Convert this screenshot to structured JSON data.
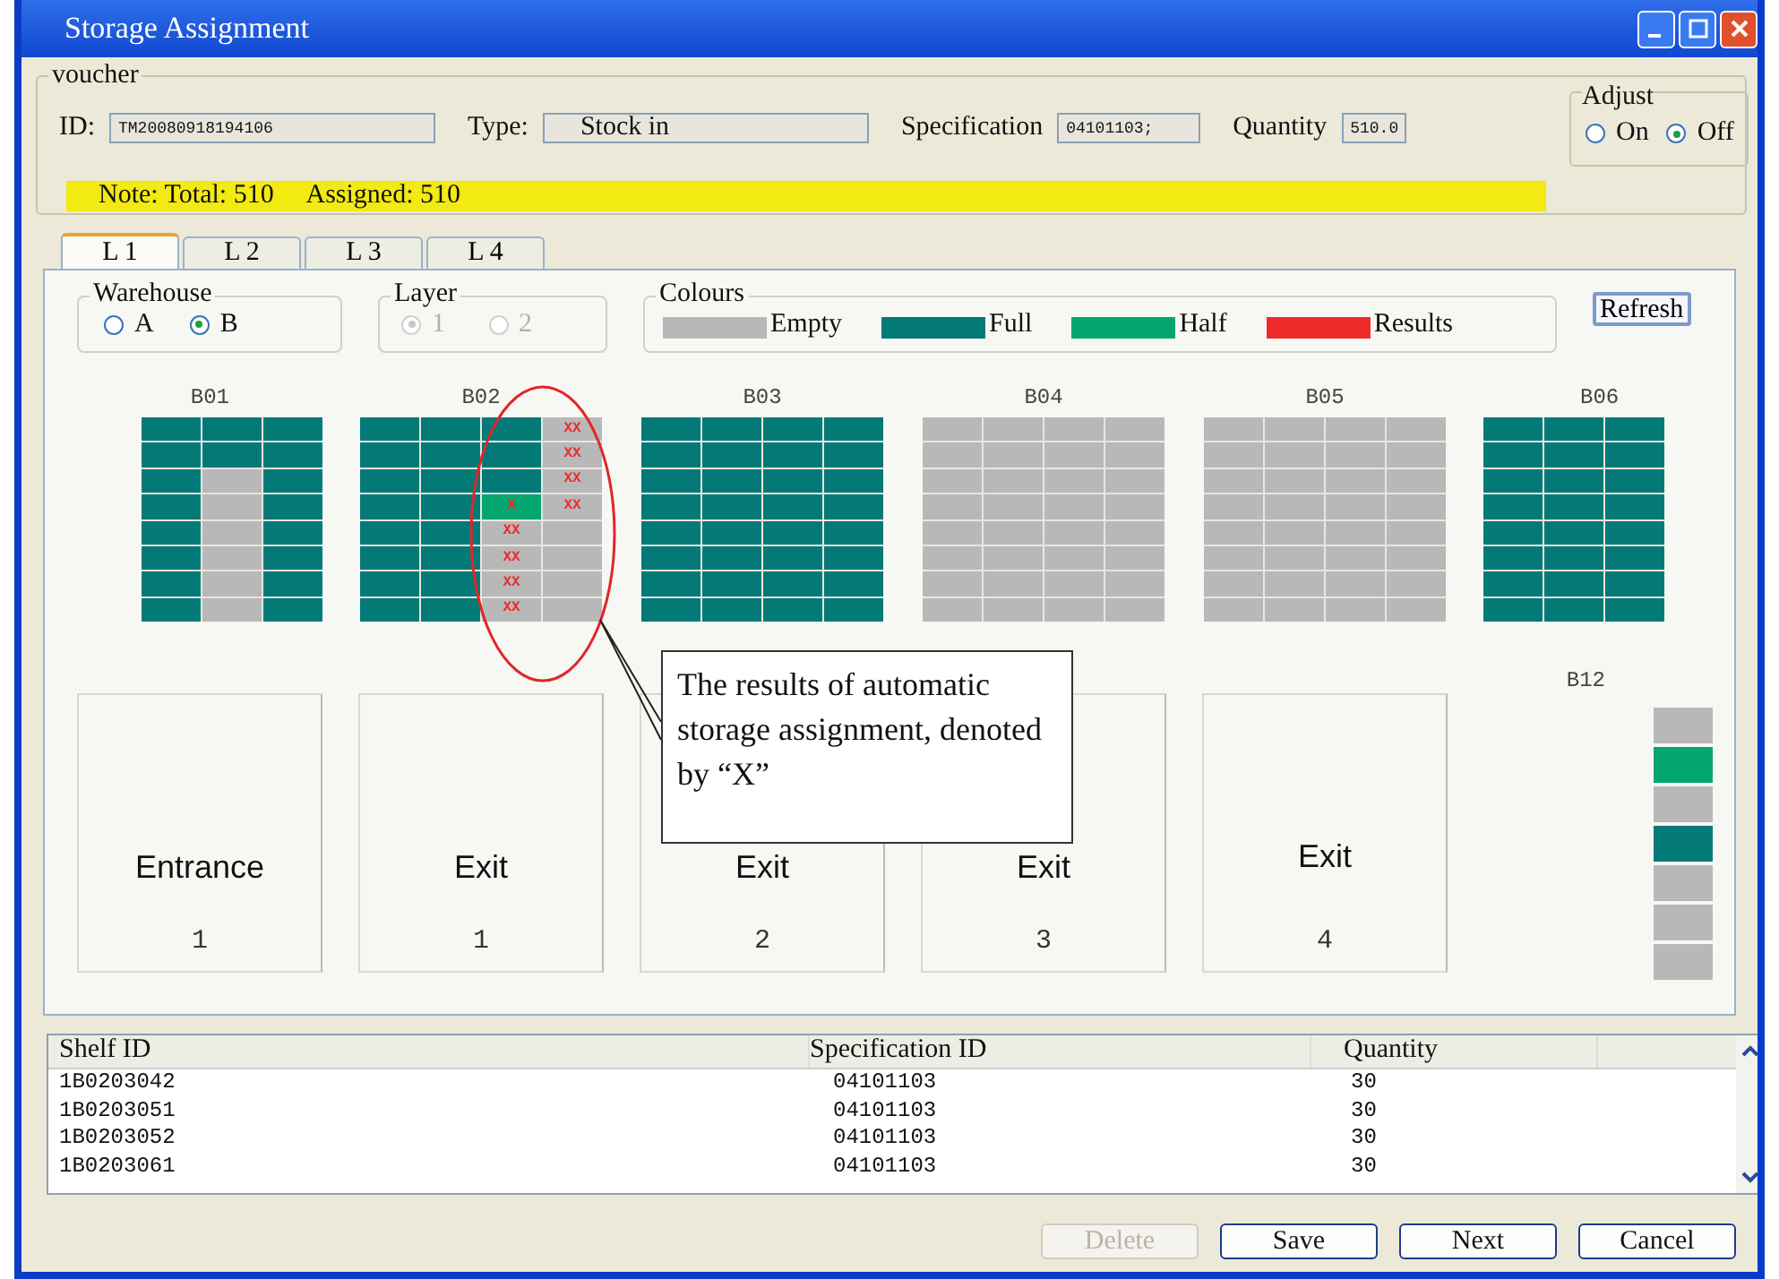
{
  "window": {
    "title": "Storage Assignment"
  },
  "voucher": {
    "legend": "voucher",
    "fields": [
      {
        "label": "ID:",
        "value": "TM20080918194106"
      },
      {
        "label": "Type:",
        "value": "Stock in"
      },
      {
        "label": "Specification",
        "value": "04101103;"
      },
      {
        "label": "Quantity",
        "value": "510.0"
      }
    ],
    "note": "Note: Total: 510     Assigned: 510",
    "adjust": {
      "legend": "Adjust",
      "options": [
        {
          "label": "On",
          "selected": false
        },
        {
          "label": "Off",
          "selected": true
        }
      ]
    }
  },
  "tabs": [
    {
      "label": "L 1",
      "selected": true
    },
    {
      "label": "L 2",
      "selected": false
    },
    {
      "label": "L 3",
      "selected": false
    },
    {
      "label": "L 4",
      "selected": false
    }
  ],
  "warehouse": {
    "legend": "Warehouse",
    "disabled": false,
    "options": [
      {
        "label": "A",
        "selected": false
      },
      {
        "label": "B",
        "selected": true
      }
    ]
  },
  "layer": {
    "legend": "Layer",
    "disabled": true,
    "options": [
      {
        "label": "1",
        "selected": true
      },
      {
        "label": "2",
        "selected": false
      }
    ]
  },
  "colours": {
    "legend": "Colours",
    "items": [
      {
        "kind": "empty",
        "label": "Empty",
        "color": "#b8b8b8"
      },
      {
        "kind": "full",
        "label": "Full",
        "color": "#037a78"
      },
      {
        "kind": "half",
        "label": "Half",
        "color": "#04a670"
      },
      {
        "kind": "results",
        "label": "Results",
        "color": "#ee2a2a"
      }
    ]
  },
  "refresh_button": "Refresh",
  "blocks": [
    {
      "name": "B01",
      "rows": [
        [
          {
            "kind": "full"
          },
          {
            "kind": "full"
          },
          {
            "kind": "full"
          }
        ],
        [
          {
            "kind": "full"
          },
          {
            "kind": "full"
          },
          {
            "kind": "full"
          }
        ],
        [
          {
            "kind": "full"
          },
          {
            "kind": "empty"
          },
          {
            "kind": "full"
          }
        ],
        [
          {
            "kind": "full"
          },
          {
            "kind": "empty"
          },
          {
            "kind": "full"
          }
        ],
        [
          {
            "kind": "full"
          },
          {
            "kind": "empty"
          },
          {
            "kind": "full"
          }
        ],
        [
          {
            "kind": "full"
          },
          {
            "kind": "empty"
          },
          {
            "kind": "full"
          }
        ],
        [
          {
            "kind": "full"
          },
          {
            "kind": "empty"
          },
          {
            "kind": "full"
          }
        ],
        [
          {
            "kind": "full"
          },
          {
            "kind": "empty"
          },
          {
            "kind": "full"
          }
        ]
      ]
    },
    {
      "name": "B02",
      "rows": [
        [
          {
            "kind": "full"
          },
          {
            "kind": "full"
          },
          {
            "kind": "full"
          },
          {
            "kind": "empty",
            "mark": "XX"
          }
        ],
        [
          {
            "kind": "full"
          },
          {
            "kind": "full"
          },
          {
            "kind": "full"
          },
          {
            "kind": "empty",
            "mark": "XX"
          }
        ],
        [
          {
            "kind": "full"
          },
          {
            "kind": "full"
          },
          {
            "kind": "full"
          },
          {
            "kind": "empty",
            "mark": "XX"
          }
        ],
        [
          {
            "kind": "full"
          },
          {
            "kind": "full"
          },
          {
            "kind": "half",
            "mark": "X"
          },
          {
            "kind": "empty",
            "mark": "XX"
          }
        ],
        [
          {
            "kind": "full"
          },
          {
            "kind": "full"
          },
          {
            "kind": "empty",
            "mark": "XX"
          },
          {
            "kind": "empty"
          }
        ],
        [
          {
            "kind": "full"
          },
          {
            "kind": "full"
          },
          {
            "kind": "empty",
            "mark": "XX"
          },
          {
            "kind": "empty"
          }
        ],
        [
          {
            "kind": "full"
          },
          {
            "kind": "full"
          },
          {
            "kind": "empty",
            "mark": "XX"
          },
          {
            "kind": "empty"
          }
        ],
        [
          {
            "kind": "full"
          },
          {
            "kind": "full"
          },
          {
            "kind": "empty",
            "mark": "XX"
          },
          {
            "kind": "empty"
          }
        ]
      ]
    },
    {
      "name": "B03",
      "rows": [
        [
          {
            "kind": "full"
          },
          {
            "kind": "full"
          },
          {
            "kind": "full"
          },
          {
            "kind": "full"
          }
        ],
        [
          {
            "kind": "full"
          },
          {
            "kind": "full"
          },
          {
            "kind": "full"
          },
          {
            "kind": "full"
          }
        ],
        [
          {
            "kind": "full"
          },
          {
            "kind": "full"
          },
          {
            "kind": "full"
          },
          {
            "kind": "full"
          }
        ],
        [
          {
            "kind": "full"
          },
          {
            "kind": "full"
          },
          {
            "kind": "full"
          },
          {
            "kind": "full"
          }
        ],
        [
          {
            "kind": "full"
          },
          {
            "kind": "full"
          },
          {
            "kind": "full"
          },
          {
            "kind": "full"
          }
        ],
        [
          {
            "kind": "full"
          },
          {
            "kind": "full"
          },
          {
            "kind": "full"
          },
          {
            "kind": "full"
          }
        ],
        [
          {
            "kind": "full"
          },
          {
            "kind": "full"
          },
          {
            "kind": "full"
          },
          {
            "kind": "full"
          }
        ],
        [
          {
            "kind": "full"
          },
          {
            "kind": "full"
          },
          {
            "kind": "full"
          },
          {
            "kind": "full"
          }
        ]
      ]
    },
    {
      "name": "B04",
      "rows": [
        [
          {
            "kind": "empty"
          },
          {
            "kind": "empty"
          },
          {
            "kind": "empty"
          },
          {
            "kind": "empty"
          }
        ],
        [
          {
            "kind": "empty"
          },
          {
            "kind": "empty"
          },
          {
            "kind": "empty"
          },
          {
            "kind": "empty"
          }
        ],
        [
          {
            "kind": "empty"
          },
          {
            "kind": "empty"
          },
          {
            "kind": "empty"
          },
          {
            "kind": "empty"
          }
        ],
        [
          {
            "kind": "empty"
          },
          {
            "kind": "empty"
          },
          {
            "kind": "empty"
          },
          {
            "kind": "empty"
          }
        ],
        [
          {
            "kind": "empty"
          },
          {
            "kind": "empty"
          },
          {
            "kind": "empty"
          },
          {
            "kind": "empty"
          }
        ],
        [
          {
            "kind": "empty"
          },
          {
            "kind": "empty"
          },
          {
            "kind": "empty"
          },
          {
            "kind": "empty"
          }
        ],
        [
          {
            "kind": "empty"
          },
          {
            "kind": "empty"
          },
          {
            "kind": "empty"
          },
          {
            "kind": "empty"
          }
        ],
        [
          {
            "kind": "empty"
          },
          {
            "kind": "empty"
          },
          {
            "kind": "empty"
          },
          {
            "kind": "empty"
          }
        ]
      ]
    },
    {
      "name": "B05",
      "rows": [
        [
          {
            "kind": "empty"
          },
          {
            "kind": "empty"
          },
          {
            "kind": "empty"
          },
          {
            "kind": "empty"
          }
        ],
        [
          {
            "kind": "empty"
          },
          {
            "kind": "empty"
          },
          {
            "kind": "empty"
          },
          {
            "kind": "empty"
          }
        ],
        [
          {
            "kind": "empty"
          },
          {
            "kind": "empty"
          },
          {
            "kind": "empty"
          },
          {
            "kind": "empty"
          }
        ],
        [
          {
            "kind": "empty"
          },
          {
            "kind": "empty"
          },
          {
            "kind": "empty"
          },
          {
            "kind": "empty"
          }
        ],
        [
          {
            "kind": "empty"
          },
          {
            "kind": "empty"
          },
          {
            "kind": "empty"
          },
          {
            "kind": "empty"
          }
        ],
        [
          {
            "kind": "empty"
          },
          {
            "kind": "empty"
          },
          {
            "kind": "empty"
          },
          {
            "kind": "empty"
          }
        ],
        [
          {
            "kind": "empty"
          },
          {
            "kind": "empty"
          },
          {
            "kind": "empty"
          },
          {
            "kind": "empty"
          }
        ],
        [
          {
            "kind": "empty"
          },
          {
            "kind": "empty"
          },
          {
            "kind": "empty"
          },
          {
            "kind": "empty"
          }
        ]
      ]
    },
    {
      "name": "B06",
      "rows": [
        [
          {
            "kind": "full"
          },
          {
            "kind": "full"
          },
          {
            "kind": "full"
          }
        ],
        [
          {
            "kind": "full"
          },
          {
            "kind": "full"
          },
          {
            "kind": "full"
          }
        ],
        [
          {
            "kind": "full"
          },
          {
            "kind": "full"
          },
          {
            "kind": "full"
          }
        ],
        [
          {
            "kind": "full"
          },
          {
            "kind": "full"
          },
          {
            "kind": "full"
          }
        ],
        [
          {
            "kind": "full"
          },
          {
            "kind": "full"
          },
          {
            "kind": "full"
          }
        ],
        [
          {
            "kind": "full"
          },
          {
            "kind": "full"
          },
          {
            "kind": "full"
          }
        ],
        [
          {
            "kind": "full"
          },
          {
            "kind": "full"
          },
          {
            "kind": "full"
          }
        ],
        [
          {
            "kind": "full"
          },
          {
            "kind": "full"
          },
          {
            "kind": "full"
          }
        ]
      ]
    }
  ],
  "docks": [
    {
      "label": "Entrance",
      "number": "1"
    },
    {
      "label": "Exit",
      "number": "1"
    },
    {
      "label": "Exit",
      "number": "2"
    },
    {
      "label": "Exit",
      "number": "3"
    },
    {
      "label": "Exit",
      "number": "4"
    }
  ],
  "b12": {
    "name": "B12",
    "cells": [
      {
        "kind": "empty"
      },
      {
        "kind": "half"
      },
      {
        "kind": "empty"
      },
      {
        "kind": "full"
      },
      {
        "kind": "empty"
      },
      {
        "kind": "empty"
      },
      {
        "kind": "empty"
      }
    ]
  },
  "callout": "The results of automatic storage assignment, denoted by “X”",
  "table": {
    "columns": [
      "Shelf ID",
      "Specification ID",
      "Quantity"
    ],
    "rows": [
      [
        "1B0203042",
        "04101103",
        "30"
      ],
      [
        "1B0203051",
        "04101103",
        "30"
      ],
      [
        "1B0203052",
        "04101103",
        "30"
      ],
      [
        "1B0203061",
        "04101103",
        "30"
      ]
    ]
  },
  "buttons": [
    {
      "label": "Delete",
      "disabled": true
    },
    {
      "label": "Save",
      "disabled": false
    },
    {
      "label": "Next",
      "disabled": false
    },
    {
      "label": "Cancel",
      "disabled": false
    }
  ]
}
